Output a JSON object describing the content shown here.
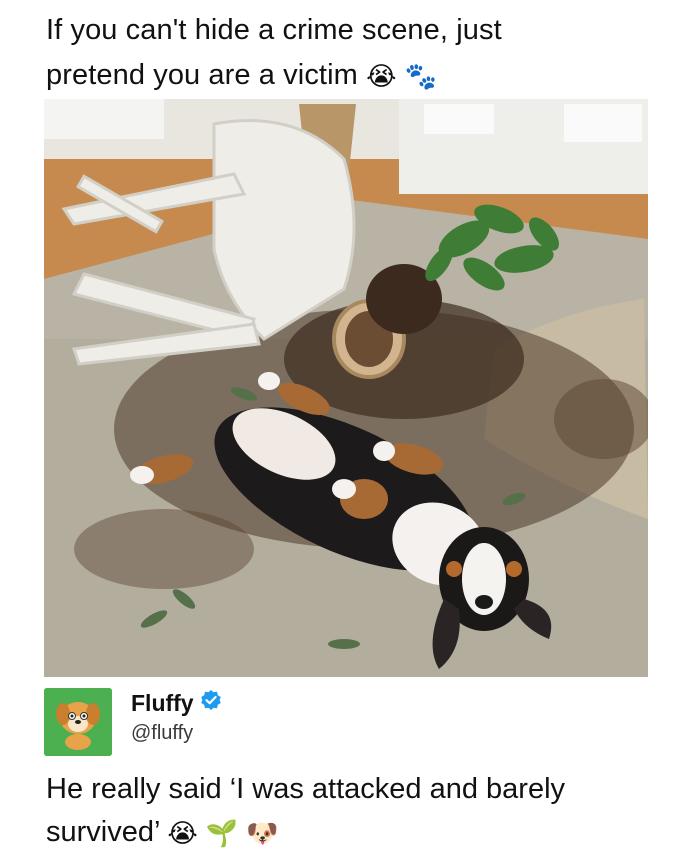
{
  "post": {
    "caption_line1": "If you can't hide a crime scene, just",
    "caption_line2": "pretend you are a victim"
  },
  "caption_emojis": [
    {
      "icon": "crying-face-icon",
      "glyph": "😭"
    },
    {
      "icon": "paw-prints-icon",
      "glyph": "🐾"
    }
  ],
  "photo": {
    "subject": "dog-lying-upside-down-among-spilled-potting-soil-icon"
  },
  "reply": {
    "author_name": "Fluffy",
    "verified": true,
    "author_handle": "@fluffy",
    "text_line1": "He really said ‘I was attacked and barely",
    "text_line2": "survived’",
    "emojis": [
      {
        "icon": "crying-face-icon",
        "glyph": "😭"
      },
      {
        "icon": "seedling-icon",
        "glyph": "🌱"
      },
      {
        "icon": "dog-face-icon",
        "glyph": "🐶"
      }
    ]
  },
  "colors": {
    "avatar_bg": "#4caf50",
    "verified_badge": "#1d9bf0",
    "text": "#111111"
  }
}
